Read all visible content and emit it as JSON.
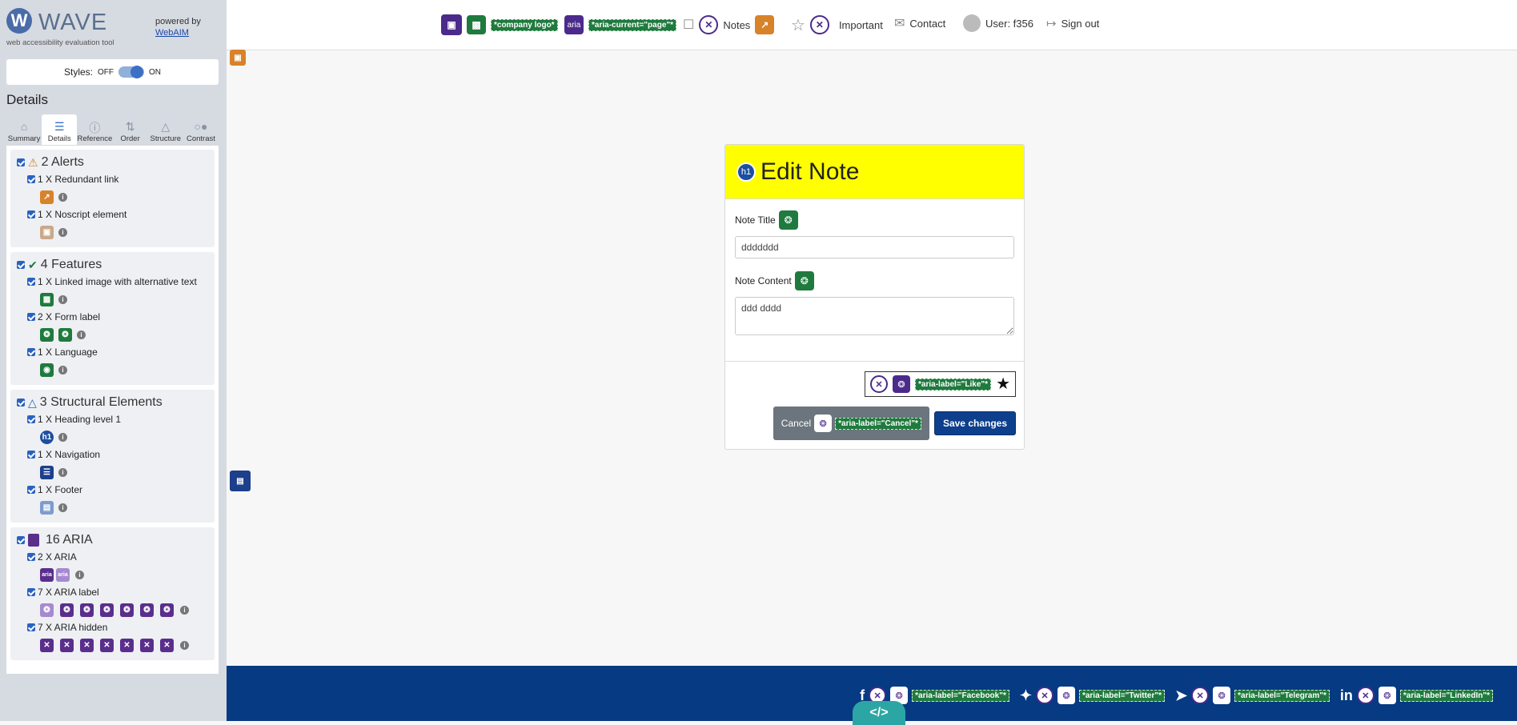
{
  "sidebar": {
    "brand": {
      "logo_letter": "W",
      "name": "WAVE",
      "subtitle": "web accessibility evaluation tool"
    },
    "powered_by": "powered by",
    "powered_link": "WebAIM",
    "styles": {
      "label": "Styles:",
      "off": "OFF",
      "on": "ON",
      "state": "on"
    },
    "details_title": "Details",
    "tabs": [
      {
        "label": "Summary",
        "icon": "home-icon"
      },
      {
        "label": "Details",
        "icon": "list-icon",
        "active": true
      },
      {
        "label": "Reference",
        "icon": "info-icon"
      },
      {
        "label": "Order",
        "icon": "order-icon"
      },
      {
        "label": "Structure",
        "icon": "structure-icon"
      },
      {
        "label": "Contrast",
        "icon": "contrast-icon"
      }
    ],
    "groups": [
      {
        "title": "2 Alerts",
        "icon": "alert-icon",
        "items": [
          {
            "label": "1 X Redundant link",
            "icons": [
              "redundant-link-icon"
            ]
          },
          {
            "label": "1 X Noscript element",
            "icons": [
              "noscript-icon"
            ]
          }
        ]
      },
      {
        "title": "4 Features",
        "icon": "check-circle-icon",
        "items": [
          {
            "label": "1 X Linked image with alternative text",
            "icons": [
              "linked-image-icon"
            ]
          },
          {
            "label": "2 X Form label",
            "icons": [
              "form-label-icon",
              "form-label-icon"
            ]
          },
          {
            "label": "1 X Language",
            "icons": [
              "language-icon"
            ]
          }
        ]
      },
      {
        "title": "3 Structural Elements",
        "icon": "structure-icon",
        "items": [
          {
            "label": "1 X Heading level 1",
            "icons": [
              "h1-icon"
            ]
          },
          {
            "label": "1 X Navigation",
            "icons": [
              "navigation-icon"
            ]
          },
          {
            "label": "1 X Footer",
            "icons": [
              "footer-icon"
            ]
          }
        ]
      },
      {
        "title": "16 ARIA",
        "icon": "aria-cube-icon",
        "items": [
          {
            "label": "2 X ARIA",
            "icons": [
              "aria-icon",
              "aria-icon"
            ]
          },
          {
            "label": "7 X ARIA label",
            "icons": [
              "aria-label-icon",
              "aria-label-icon",
              "aria-label-icon",
              "aria-label-icon",
              "aria-label-icon",
              "aria-label-icon",
              "aria-label-icon"
            ]
          },
          {
            "label": "7 X ARIA hidden",
            "icons": [
              "aria-hidden-icon",
              "aria-hidden-icon",
              "aria-hidden-icon",
              "aria-hidden-icon",
              "aria-hidden-icon",
              "aria-hidden-icon",
              "aria-hidden-icon"
            ]
          }
        ]
      }
    ]
  },
  "header": {
    "company_logo_tag": "*company logo*",
    "aria_text": "aria",
    "aria_current_tag": "*aria-current=\"page\"*",
    "notes": "Notes",
    "important": "Important",
    "contact": "Contact",
    "user": "User: f356",
    "sign_out": "Sign out"
  },
  "card": {
    "heading_badge": "h1",
    "title": "Edit Note",
    "note_title_label": "Note Title",
    "note_title_value": "ddddddd",
    "note_content_label": "Note Content",
    "note_content_value": "ddd dddd",
    "like_tag": "*aria-label=\"Like\"*",
    "cancel_label": "Cancel",
    "cancel_tag": "*aria-label=\"Cancel\"*",
    "save_label": "Save changes"
  },
  "footer": {
    "facebook_tag": "*aria-label=\"Facebook\"*",
    "twitter_tag": "*aria-label=\"Twitter\"*",
    "telegram_tag": "*aria-label=\"Telegram\"*",
    "linkedin_tag": "*aria-label=\"LinkedIn\"*",
    "code_badge": "</>"
  },
  "colors": {
    "sidebar_bg": "#d6dae1",
    "card_header": "#ffff00",
    "footer_bg": "#063a82",
    "save_button": "#0d3f8c",
    "cancel_button": "#6c757d",
    "feature_green": "#1f7a3e",
    "aria_purple": "#4b2a8c"
  }
}
